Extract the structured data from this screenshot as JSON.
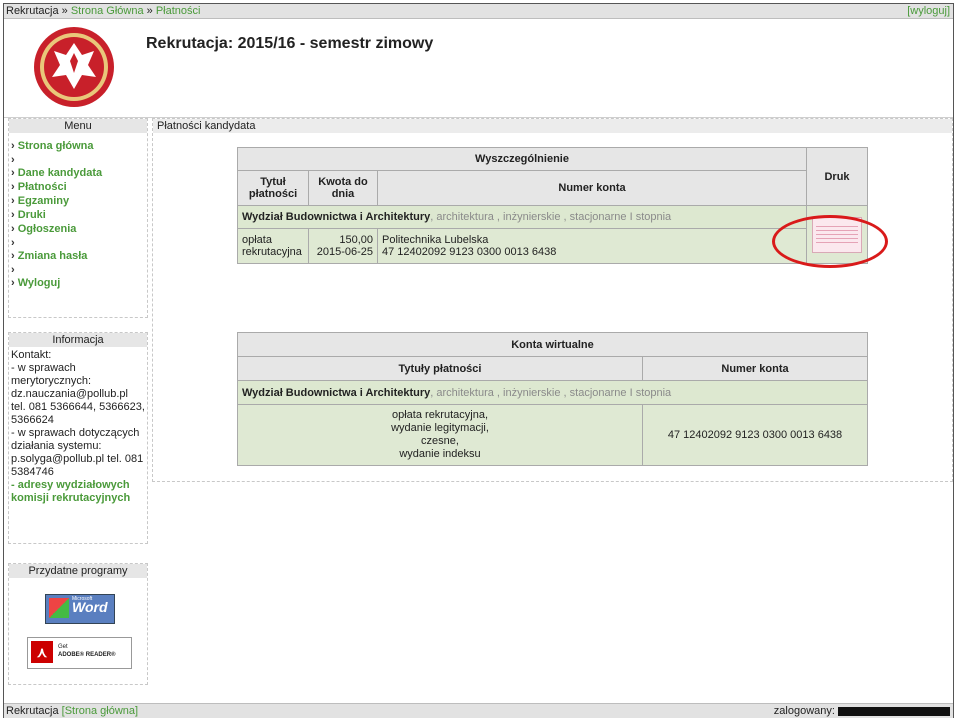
{
  "topbar": {
    "crumb_root": "Rekrutacja",
    "crumb_sep": "»",
    "crumb_home": "Strona Główna",
    "crumb_current": "Płatności",
    "logout": "[wyloguj]"
  },
  "header": {
    "title": "Rekrutacja: 2015/16 - semestr zimowy"
  },
  "menu": {
    "title": "Menu",
    "items": [
      "Strona główna",
      "Dane kandydata",
      "Płatności",
      "Egzaminy",
      "Druki",
      "Ogłoszenia",
      "Zmiana hasła",
      "Wyloguj"
    ]
  },
  "info": {
    "title": "Informacja",
    "lines": [
      "Kontakt:",
      "- w sprawach merytorycznych:",
      "dz.nauczania@pollub.pl",
      "tel. 081 5366644, 5366623, 5366624",
      "- w sprawach dotyczących działania systemu:",
      "p.solyga@pollub.pl tel. 081 5384746"
    ],
    "link": "- adresy wydziałowych komisji rekrutacyjnych"
  },
  "programs": {
    "title": "Przydatne programy",
    "word": "Word",
    "word_ms": "Microsoft",
    "adobe_get": "Get",
    "adobe_reader": "ADOBE® READER®"
  },
  "main": {
    "title": "Płatności kandydata"
  },
  "payments": {
    "header_group": "Wyszczególnienie",
    "header_print": "Druk",
    "col_title": "Tytuł płatności",
    "col_amount": "Kwota do dnia",
    "col_account": "Numer konta",
    "faculty": "Wydział Budownictwa i Architektury",
    "faculty_details": ", architektura , inżynierskie , stacjonarne I stopnia",
    "row": {
      "title": "opłata rekrutacyjna",
      "amount": "150,00",
      "date": "2015-06-25",
      "recipient": "Politechnika Lubelska",
      "account": "47 12402092 9123 0300 0013 6438"
    }
  },
  "virtual": {
    "header": "Konta wirtualne",
    "col_titles": "Tytuły płatności",
    "col_account": "Numer konta",
    "faculty": "Wydział Budownictwa i Architektury",
    "faculty_details": ", architektura , inżynierskie , stacjonarne I stopnia",
    "titles": [
      "opłata rekrutacyjna,",
      "wydanie legitymacji,",
      "czesne,",
      "wydanie indeksu"
    ],
    "account": "47 12402092 9123 0300 0013 6438"
  },
  "bottombar": {
    "left_text": "Rekrutacja",
    "left_link": "[Strona główna]",
    "logged_label": "zalogowany:"
  },
  "colors": {
    "link_green": "#4a9a3a",
    "highlight_red": "#d91a1a",
    "row_green": "#dfe9d3"
  }
}
